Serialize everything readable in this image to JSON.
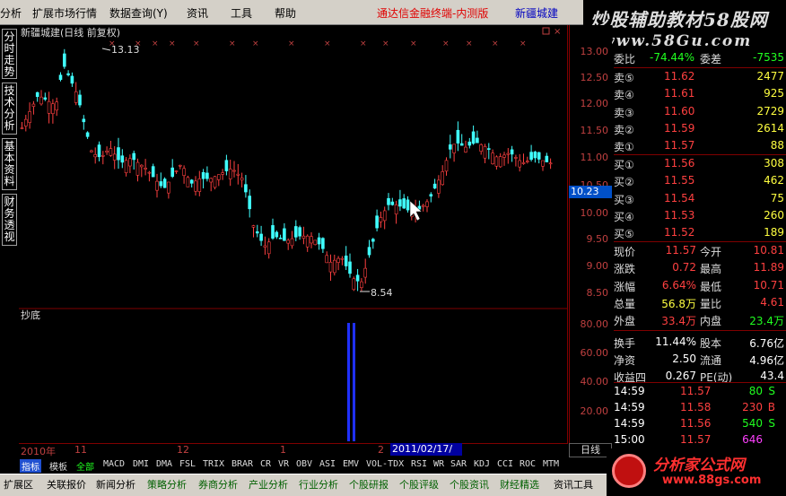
{
  "menu": {
    "items": [
      "分析",
      "扩展市场行情",
      "数据查询(Y)",
      "资讯",
      "工具",
      "帮助"
    ],
    "product": "通达信金融终端-内测版",
    "stock": "新疆城建"
  },
  "watermark": {
    "line1": "炒股辅助教材58股网",
    "line2": "www.58Gu.com"
  },
  "sidetabs": [
    "分时走势",
    "技术分析",
    "基本资料",
    "财务透视"
  ],
  "chart": {
    "title": "新疆城建(日线 前复权)",
    "high_label": "13.13",
    "low_label": "8.54",
    "indicator_title": "抄底",
    "current_price": "10.23"
  },
  "chart_data": [
    {
      "type": "candlestick",
      "title": "新疆城建(日线 前复权)",
      "ylim": [
        8.3,
        13.2
      ],
      "yticks": [
        "13.00",
        "12.50",
        "12.00",
        "11.50",
        "11.00",
        "10.50",
        "10.00",
        "9.50",
        "9.00",
        "8.50"
      ],
      "annotations": [
        {
          "text": "13.13",
          "value": 13.13
        },
        {
          "text": "8.54",
          "value": 8.54
        }
      ],
      "current_value": 10.23
    },
    {
      "type": "bar",
      "title": "抄底",
      "ylim": [
        0,
        100
      ],
      "yticks": [
        "80.00",
        "60.00",
        "40.00",
        "20.00"
      ],
      "values": [
        100,
        100
      ]
    }
  ],
  "timeaxis": {
    "labels": [
      "2010年",
      "11",
      "12",
      "1",
      "2"
    ],
    "date": "2011/02/17/四",
    "period": "日线"
  },
  "indicators": [
    "指标",
    "模板",
    "全部",
    "MACD",
    "DMI",
    "DMA",
    "FSL",
    "TRIX",
    "BRAR",
    "CR",
    "VR",
    "OBV",
    "ASI",
    "EMV",
    "VOL-TDX",
    "RSI",
    "WR",
    "SAR",
    "KDJ",
    "CCI",
    "ROC",
    "MTM"
  ],
  "bottom_tabs": [
    "扩展区",
    "关联报价",
    "新闻分析",
    "策略分析",
    "券商分析",
    "产业分析",
    "行业分析",
    "个股研报",
    "个股评级",
    "个股资讯",
    "财经精选",
    "资讯工具"
  ],
  "quote": {
    "weibi_label": "委比",
    "weibi": "-74.44%",
    "weicha_label": "委差",
    "weicha": "-7535",
    "asks": [
      {
        "label": "卖⑤",
        "price": "11.62",
        "vol": "2477"
      },
      {
        "label": "卖④",
        "price": "11.61",
        "vol": "925"
      },
      {
        "label": "卖③",
        "price": "11.60",
        "vol": "2729"
      },
      {
        "label": "卖②",
        "price": "11.59",
        "vol": "2614"
      },
      {
        "label": "卖①",
        "price": "11.57",
        "vol": "88"
      }
    ],
    "bids": [
      {
        "label": "买①",
        "price": "11.56",
        "vol": "308"
      },
      {
        "label": "买②",
        "price": "11.55",
        "vol": "462"
      },
      {
        "label": "买③",
        "price": "11.54",
        "vol": "75"
      },
      {
        "label": "买④",
        "price": "11.53",
        "vol": "260"
      },
      {
        "label": "买⑤",
        "price": "11.52",
        "vol": "189"
      }
    ],
    "stats": [
      {
        "l1": "现价",
        "v1": "11.57",
        "l2": "今开",
        "v2": "10.81",
        "c1": "red",
        "c2": "red"
      },
      {
        "l1": "涨跌",
        "v1": "0.72",
        "l2": "最高",
        "v2": "11.89",
        "c1": "red",
        "c2": "red"
      },
      {
        "l1": "涨幅",
        "v1": "6.64%",
        "l2": "最低",
        "v2": "10.71",
        "c1": "red",
        "c2": "red"
      },
      {
        "l1": "总量",
        "v1": "56.8万",
        "l2": "量比",
        "v2": "4.61",
        "c1": "yel",
        "c2": "red"
      },
      {
        "l1": "外盘",
        "v1": "33.4万",
        "l2": "内盘",
        "v2": "23.4万",
        "c1": "red",
        "c2": "grn"
      },
      {
        "l1": "换手",
        "v1": "11.44%",
        "l2": "股本",
        "v2": "6.76亿",
        "c1": "wht",
        "c2": "wht"
      },
      {
        "l1": "净资",
        "v1": "2.50",
        "l2": "流通",
        "v2": "4.96亿",
        "c1": "wht",
        "c2": "wht"
      },
      {
        "l1": "收益四",
        "v1": "0.267",
        "l2": "PE(动)",
        "v2": "43.4",
        "c1": "wht",
        "c2": "wht"
      }
    ],
    "ticks": [
      {
        "time": "14:59",
        "price": "11.57",
        "vol": "80",
        "side": "S"
      },
      {
        "time": "14:59",
        "price": "11.58",
        "vol": "230",
        "side": "B"
      },
      {
        "time": "14:59",
        "price": "11.56",
        "vol": "540",
        "side": "S"
      },
      {
        "time": "15:00",
        "price": "11.57",
        "vol": "646",
        "side": ""
      }
    ]
  },
  "logo": {
    "line1": "分析家公式网",
    "line2": "www.88gs.com"
  }
}
